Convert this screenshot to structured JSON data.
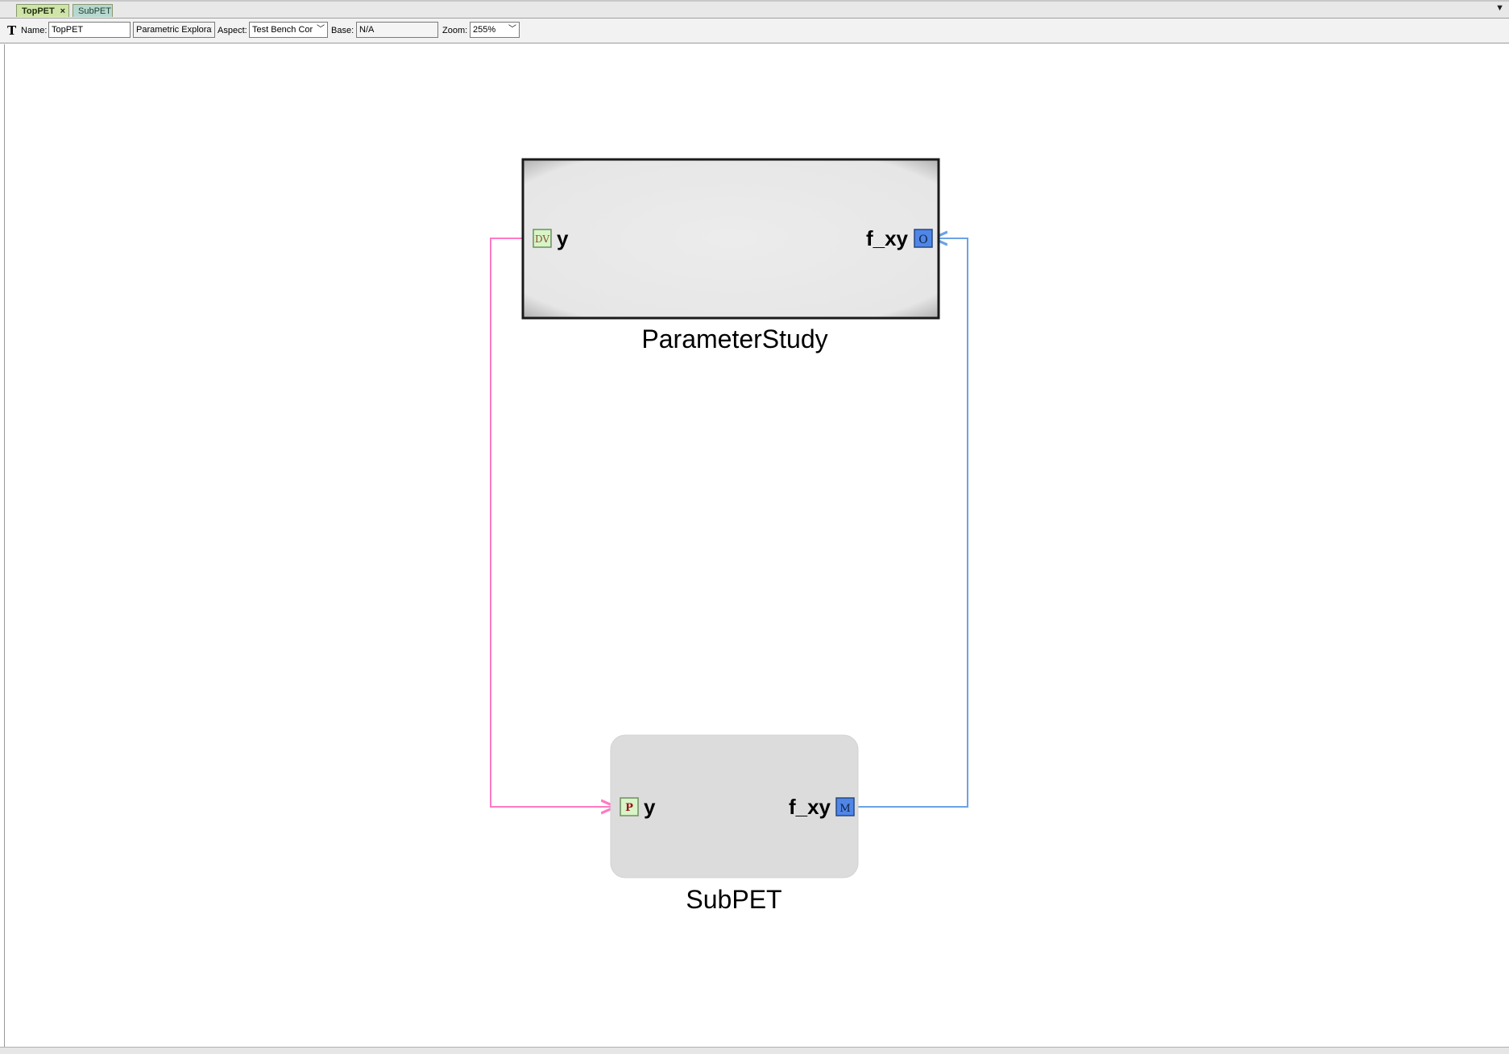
{
  "tabs": [
    {
      "label": "TopPET",
      "active": true,
      "close": "×"
    },
    {
      "label": "SubPET",
      "active": false
    }
  ],
  "toolbar": {
    "name_label": "Name:",
    "name_value": "TopPET",
    "kind_value": "Parametric Exploratic",
    "aspect_label": "Aspect:",
    "aspect_value": "Test Bench Cor",
    "base_label": "Base:",
    "base_value": "N/A",
    "zoom_label": "Zoom:",
    "zoom_value": "255%"
  },
  "diagram": {
    "parameter_study": {
      "label": "ParameterStudy",
      "in_port": {
        "badge": "DV",
        "name": "y"
      },
      "out_port": {
        "badge": "O",
        "name": "f_xy"
      }
    },
    "subpet": {
      "label": "SubPET",
      "in_port": {
        "badge": "P",
        "name": "y"
      },
      "out_port": {
        "badge": "M",
        "name": "f_xy"
      }
    }
  },
  "colors": {
    "design_variable_connection": "#ff7ac3",
    "metric_connection": "#6aa3e6",
    "parameter_port": "#d7f5c7",
    "metric_port": "#4f86e8",
    "block_fill": "#e8e8e8",
    "subpet_fill": "#dcdcdc"
  }
}
